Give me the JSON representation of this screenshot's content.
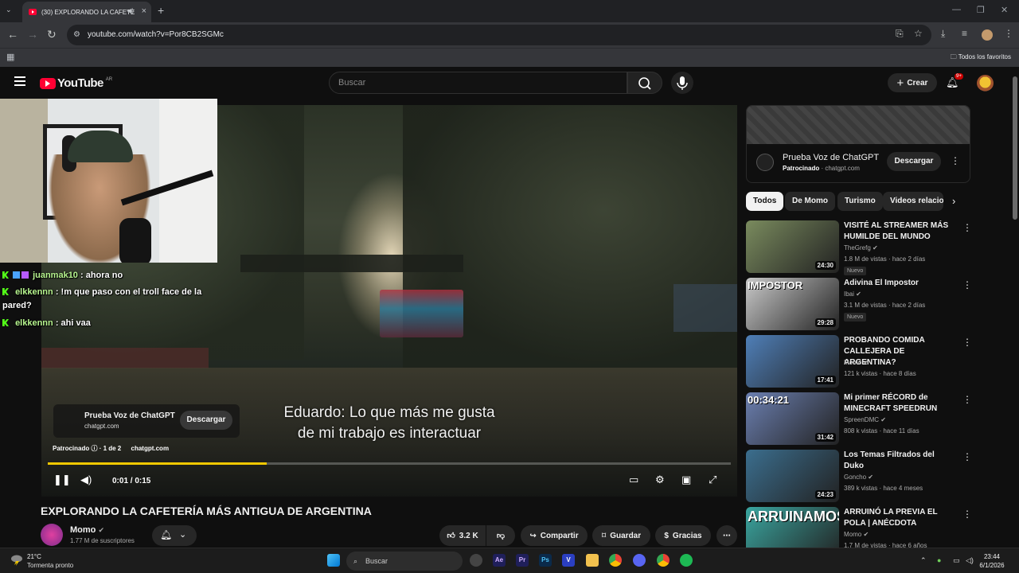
{
  "browser": {
    "tab_title": "(30) EXPLORANDO LA CAFETE",
    "url": "youtube.com/watch?v=Por8CB2SGMc",
    "bookmarks_label": "Todos los favoritos"
  },
  "header": {
    "logo_text": "YouTube",
    "region": "AR",
    "search_placeholder": "Buscar",
    "create_label": "Crear",
    "notifications_badge": "9+"
  },
  "stream_overlay": {
    "chat": [
      {
        "user": "juanmak10",
        "message": ": ahora no"
      },
      {
        "user": "elkkennn",
        "message": ": !m que paso con el troll face de la pared?"
      },
      {
        "user": "elkkennn",
        "message": ": ahi vaa"
      }
    ]
  },
  "player": {
    "subtitle_line1": "Eduardo: Lo que más me gusta",
    "subtitle_line2": "de mi trabajo es interactuar",
    "ad_title": "Prueba Voz de ChatGPT",
    "ad_domain": "chatgpt.com",
    "ad_button": "Descargar",
    "ad_sponsored": "Patrocinado",
    "ad_count": "1 de 2",
    "ad_site": "chatgpt.com",
    "time": "0:01 / 0:15",
    "progress_fraction": 0.32
  },
  "video": {
    "title": "EXPLORANDO LA CAFETERÍA MÁS ANTIGUA DE ARGENTINA",
    "channel": "Momo",
    "subscribers": "1.77 M de suscriptores",
    "likes": "3.2 K",
    "share_label": "Compartir",
    "save_label": "Guardar",
    "thanks_label": "Gracias"
  },
  "sidebar": {
    "ad": {
      "title": "Prueba Voz de ChatGPT",
      "sponsored": "Patrocinado",
      "domain": "chatgpt.com",
      "button": "Descargar"
    },
    "chips": [
      "Todos",
      "De Momo",
      "Turismo",
      "Videos relacio"
    ],
    "recommendations": [
      {
        "title": "VISITÉ AL STREAMER MÁS HUMILDE DEL MUNDO",
        "channel": "TheGrefg",
        "meta": "1.8 M de vistas · hace 2 días",
        "duration": "24:30",
        "badge": "Nuevo",
        "thumb_color": "#7a8b5e"
      },
      {
        "title": "Adivina El Impostor",
        "channel": "Ibai",
        "meta": "3.1 M de vistas · hace 2 días",
        "duration": "29:28",
        "badge": "Nuevo",
        "thumb_color": "#c9c9c9",
        "thumb_text": "IMPOSTOR"
      },
      {
        "title": "PROBANDO COMIDA CALLEJERA DE ARGENTINA?",
        "channel": "Momo",
        "meta": "121 k vistas · hace 8 días",
        "duration": "17:41",
        "badge": "",
        "thumb_color": "#4f7fb8"
      },
      {
        "title": "Mi primer RÉCORD de MINECRAFT SPEEDRUN",
        "channel": "SpreenDMC",
        "meta": "808 k vistas · hace 11 días",
        "duration": "31:42",
        "badge": "",
        "thumb_color": "#6b7fb0",
        "thumb_text": "00:34:21"
      },
      {
        "title": "Los Temas Filtrados del Duko",
        "channel": "Goncho",
        "meta": "389 k vistas · hace 4 meses",
        "duration": "24:23",
        "badge": "",
        "thumb_color": "#3b6e8e"
      },
      {
        "title": "ARRUINÓ LA PREVIA EL POLA | ANÉCDOTA",
        "channel": "Momo",
        "meta": "1.7 M de vistas · hace 6 años",
        "duration": "",
        "badge": "",
        "thumb_color": "#3aa6a0",
        "thumb_text": "ARRUINAMOS"
      }
    ]
  },
  "taskbar": {
    "temp": "21°C",
    "weather": "Tormenta pronto",
    "search": "Buscar",
    "time": "23:44",
    "date": "6/1/2026"
  }
}
